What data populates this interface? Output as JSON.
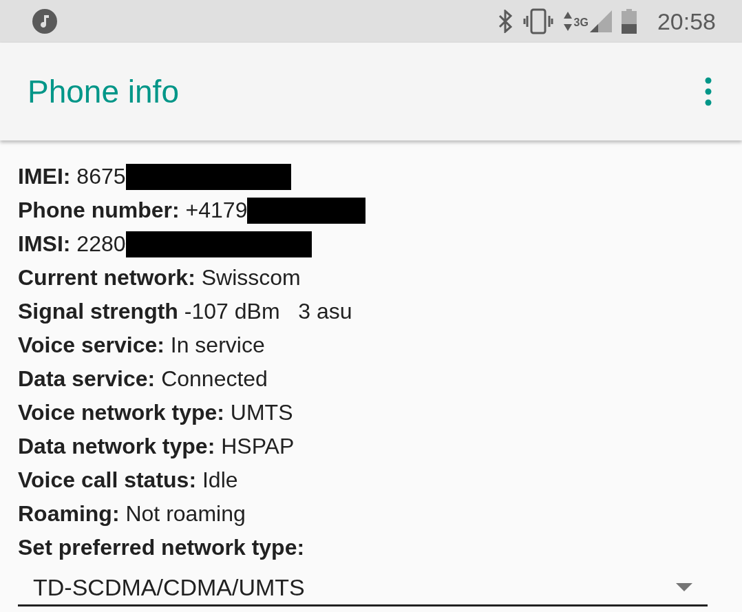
{
  "status_bar": {
    "network_label": "3G",
    "time": "20:58"
  },
  "app_bar": {
    "title": "Phone info"
  },
  "rows": [
    {
      "label": "IMEI:",
      "value": "8675",
      "redacted": true
    },
    {
      "label": "Phone number:",
      "value": "+4179",
      "redacted": true
    },
    {
      "label": "IMSI:",
      "value": "2280",
      "redacted": true
    },
    {
      "label": "Current network:",
      "value": "Swisscom",
      "redacted": false
    },
    {
      "label": "Signal strength",
      "value": "-107 dBm   3 asu",
      "redacted": false
    },
    {
      "label": "Voice service:",
      "value": "In service",
      "redacted": false
    },
    {
      "label": "Data service:",
      "value": "Connected",
      "redacted": false
    },
    {
      "label": "Voice network type:",
      "value": "UMTS",
      "redacted": false
    },
    {
      "label": "Data network type:",
      "value": "HSPAP",
      "redacted": false
    },
    {
      "label": "Voice call status:",
      "value": "Idle",
      "redacted": false
    },
    {
      "label": "Roaming:",
      "value": "Not roaming",
      "redacted": false
    }
  ],
  "preferred_network": {
    "label": "Set preferred network type:",
    "value": "TD-SCDMA/CDMA/UMTS"
  }
}
